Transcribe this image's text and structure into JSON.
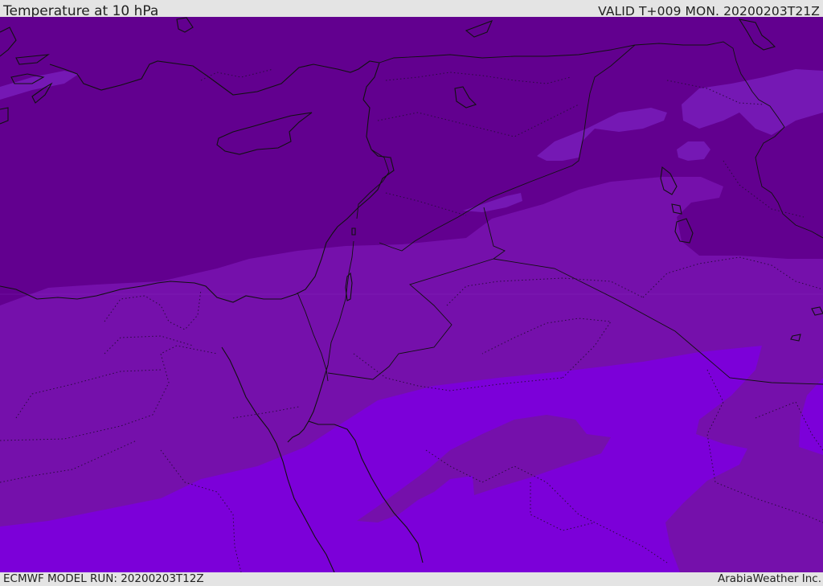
{
  "header": {
    "title": "Temperature at 10 hPa",
    "valid": "VALID T+009 MON. 20200203T21Z"
  },
  "footer": {
    "model_run": "ECMWF MODEL RUN: 20200203T12Z",
    "credit": "ArabiaWeather Inc."
  },
  "map": {
    "colors": {
      "coldest_band": "#62008f",
      "cold_band": "#7510ab",
      "warm_band": "#7c00d9",
      "highlight_band": "#7518b4",
      "coastline": "#111111",
      "border": "#111111"
    }
  }
}
